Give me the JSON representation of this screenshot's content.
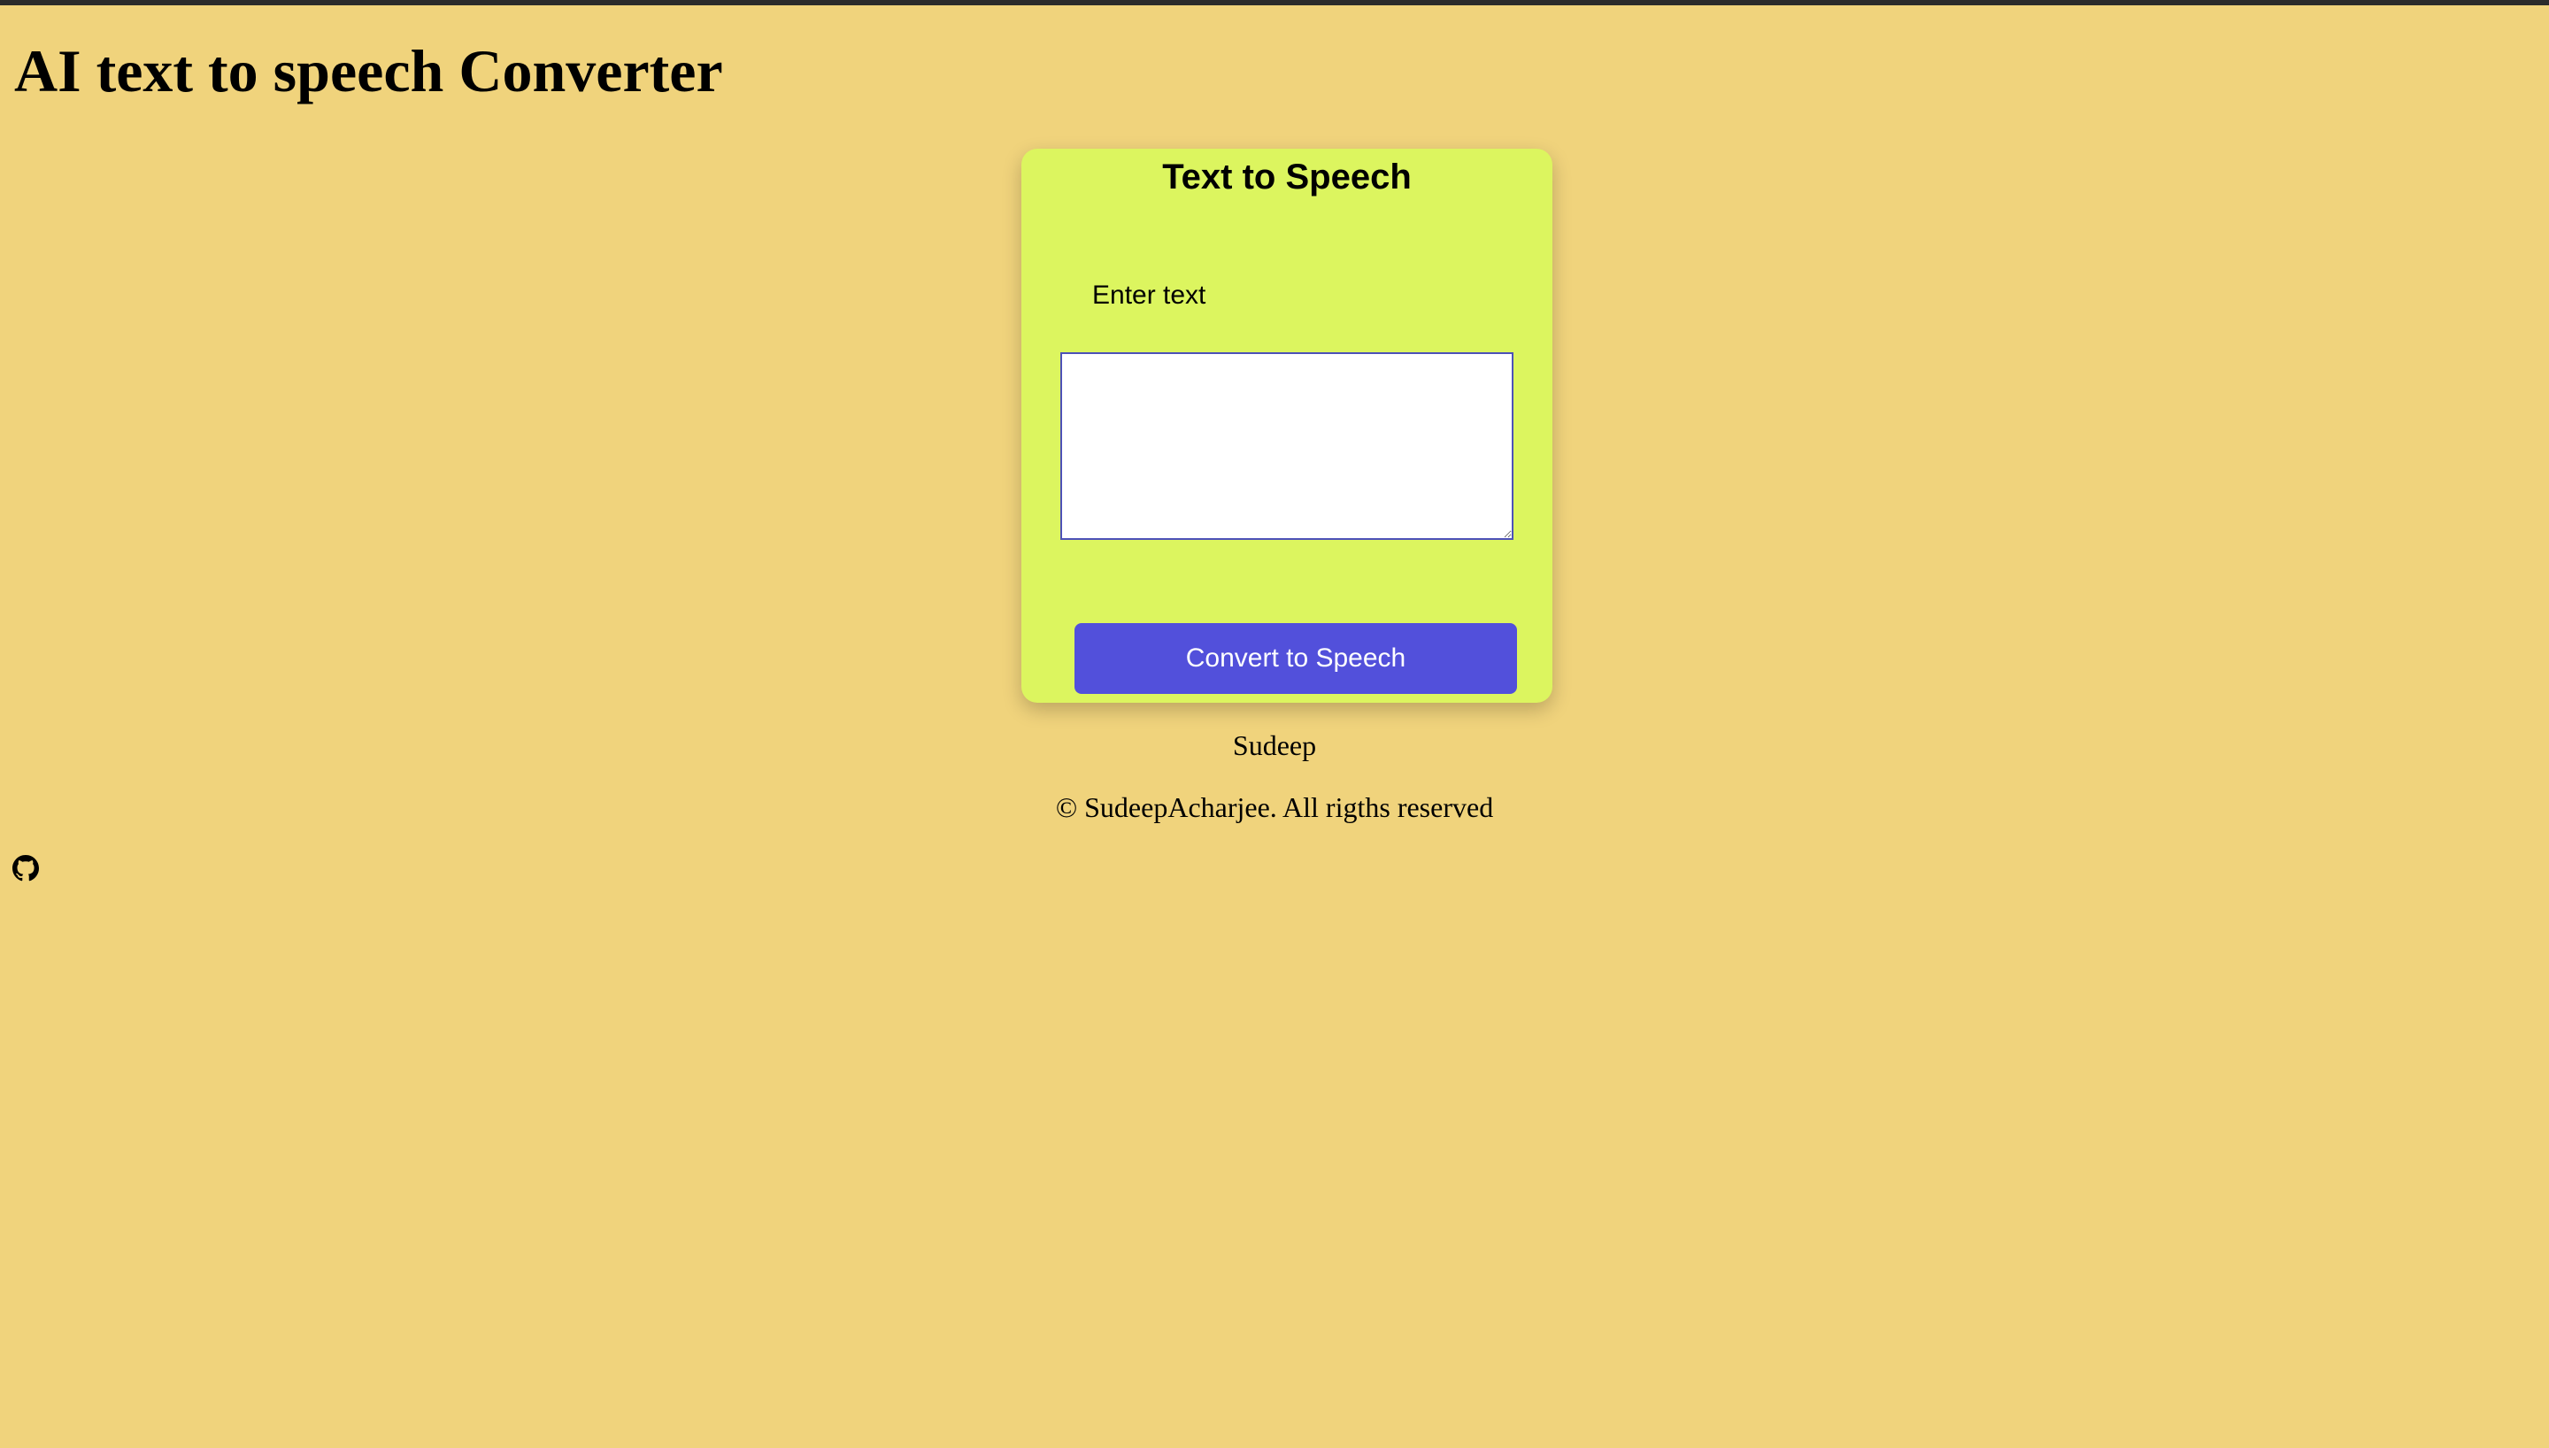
{
  "header": {
    "title": "AI text to speech Converter"
  },
  "card": {
    "title": "Text to Speech",
    "input_label": "Enter text",
    "textarea_value": "",
    "button_label": "Convert to Speech"
  },
  "footer": {
    "name": "Sudeep",
    "copyright": "© SudeepAcharjee. All rigths reserved",
    "social_icon": "github-icon"
  },
  "colors": {
    "page_background": "#f0d37c",
    "card_background": "#dcf55f",
    "button_background": "#5250db",
    "button_text": "#ffffff",
    "textarea_border": "#4d51b8"
  }
}
